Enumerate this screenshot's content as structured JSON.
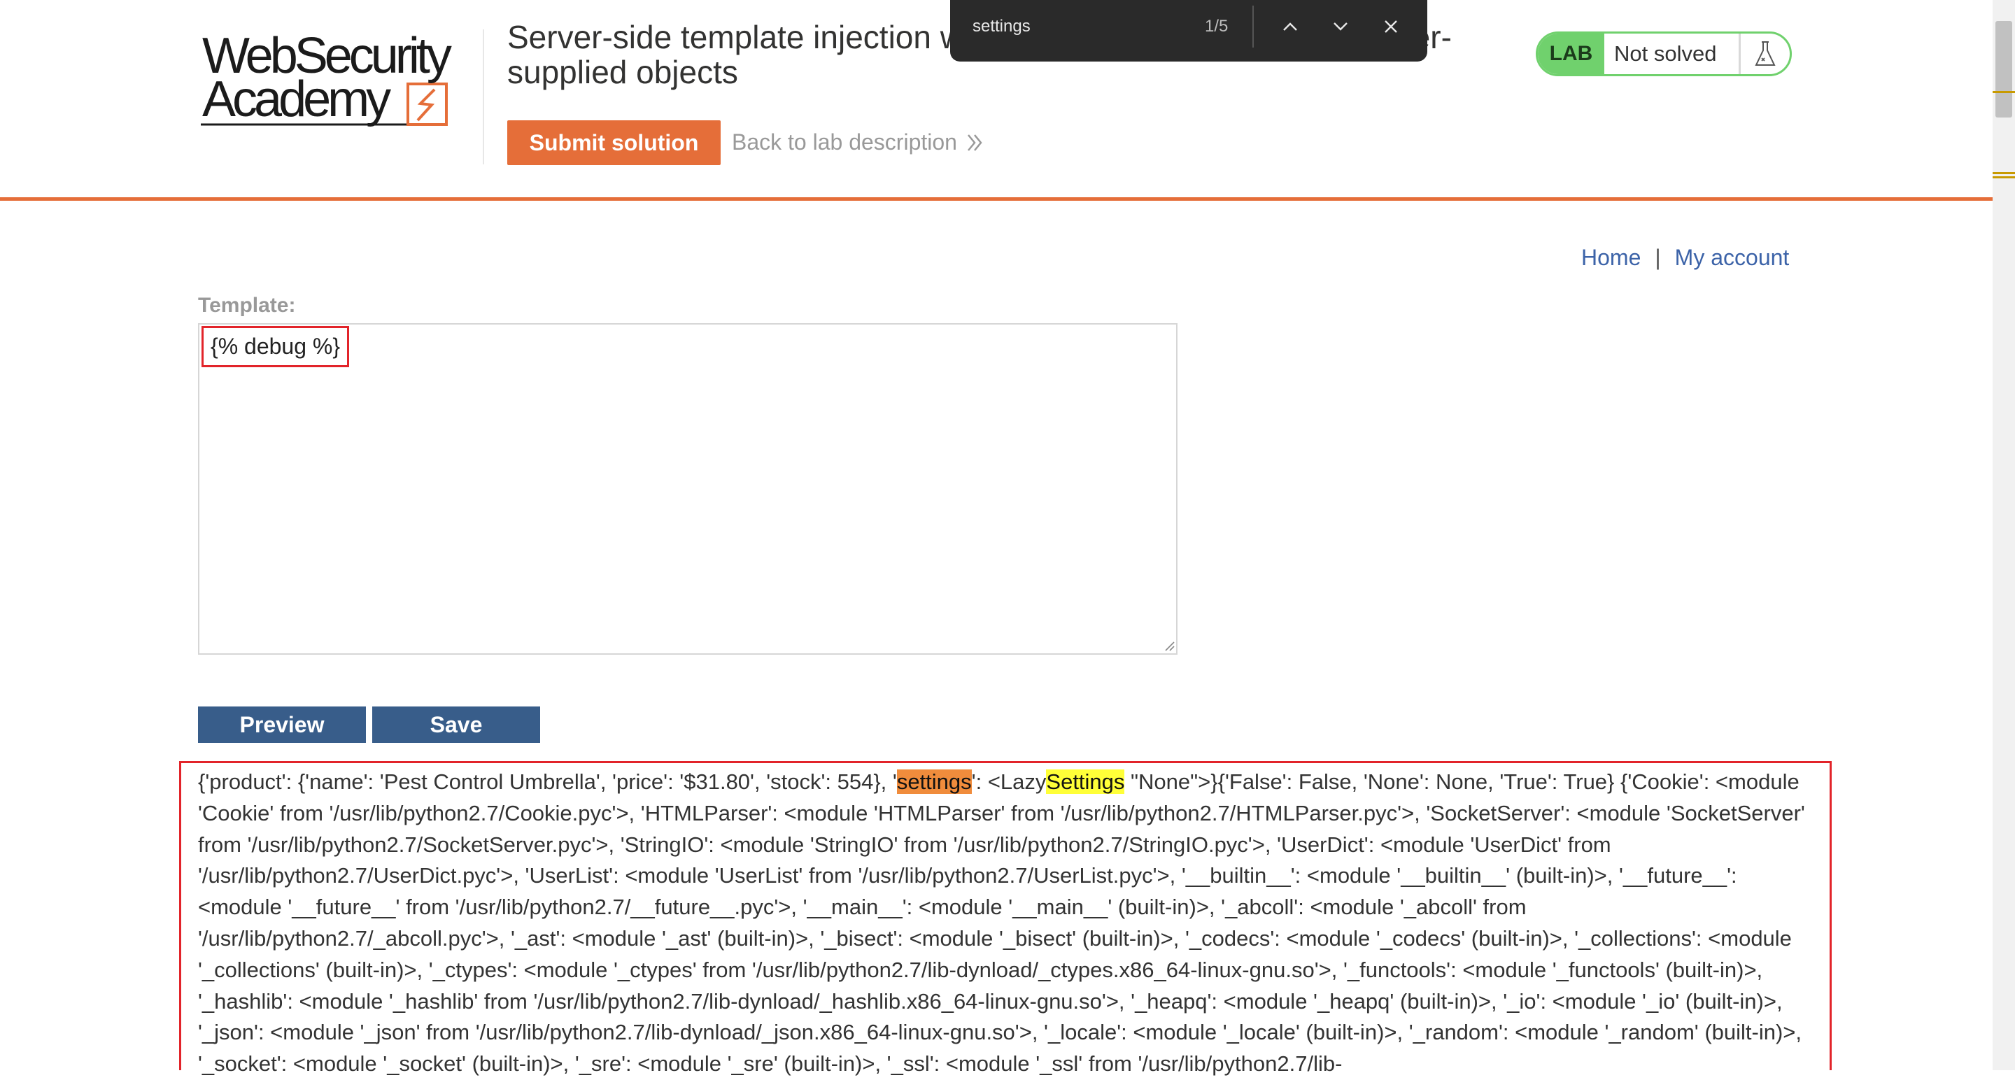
{
  "header": {
    "logo": {
      "line1": "WebSecurity",
      "line2": "Academy"
    },
    "lab_title": "Server-side template injection with information disclosure via user-supplied objects",
    "submit_label": "Submit solution",
    "back_label": "Back to lab description",
    "lab_badge": "LAB",
    "lab_status": "Not solved"
  },
  "find_bar": {
    "query": "settings",
    "count": "1/5",
    "icons": [
      "chevron-up-icon",
      "chevron-down-icon",
      "close-icon"
    ]
  },
  "nav": {
    "home": "Home",
    "separator": "|",
    "my_account": "My account"
  },
  "form": {
    "template_label": "Template:",
    "template_value": "{% debug %}",
    "preview_label": "Preview",
    "save_label": "Save"
  },
  "output": {
    "before": "{'product': {'name': 'Pest Control Umbrella', 'price': '$31.80', 'stock': 554}, '",
    "match1": "settings",
    "mid1": "': <Lazy",
    "match2": "Settings",
    "after": " \"None\">}{'False': False, 'None': None, 'True': True} {'Cookie': <module 'Cookie' from '/usr/lib/python2.7/Cookie.pyc'>, 'HTMLParser': <module 'HTMLParser' from '/usr/lib/python2.7/HTMLParser.pyc'>, 'SocketServer': <module 'SocketServer' from '/usr/lib/python2.7/SocketServer.pyc'>, 'StringIO': <module 'StringIO' from '/usr/lib/python2.7/StringIO.pyc'>, 'UserDict': <module 'UserDict' from '/usr/lib/python2.7/UserDict.pyc'>, 'UserList': <module 'UserList' from '/usr/lib/python2.7/UserList.pyc'>, '__builtin__': <module '__builtin__' (built-in)>, '__future__': <module '__future__' from '/usr/lib/python2.7/__future__.pyc'>, '__main__': <module '__main__' (built-in)>, '_abcoll': <module '_abcoll' from '/usr/lib/python2.7/_abcoll.pyc'>, '_ast': <module '_ast' (built-in)>, '_bisect': <module '_bisect' (built-in)>, '_codecs': <module '_codecs' (built-in)>, '_collections': <module '_collections' (built-in)>, '_ctypes': <module '_ctypes' from '/usr/lib/python2.7/lib-dynload/_ctypes.x86_64-linux-gnu.so'>, '_functools': <module '_functools' (built-in)>, '_hashlib': <module '_hashlib' from '/usr/lib/python2.7/lib-dynload/_hashlib.x86_64-linux-gnu.so'>, '_heapq': <module '_heapq' (built-in)>, '_io': <module '_io' (built-in)>, '_json': <module '_json' from '/usr/lib/python2.7/lib-dynload/_json.x86_64-linux-gnu.so'>, '_locale': <module '_locale' (built-in)>, '_random': <module '_random' (built-in)>, '_socket': <module '_socket' (built-in)>, '_sre': <module '_sre' (built-in)>, '_ssl': <module '_ssl' from '/usr/lib/python2.7/lib-"
  },
  "colors": {
    "accent_orange": "#e56e39",
    "lab_green": "#70d16d",
    "button_blue": "#385d8a",
    "link_blue": "#3c63a8",
    "highlight_red": "#e2242a",
    "find_current": "#f08c3c",
    "find_match": "#ffff38"
  }
}
